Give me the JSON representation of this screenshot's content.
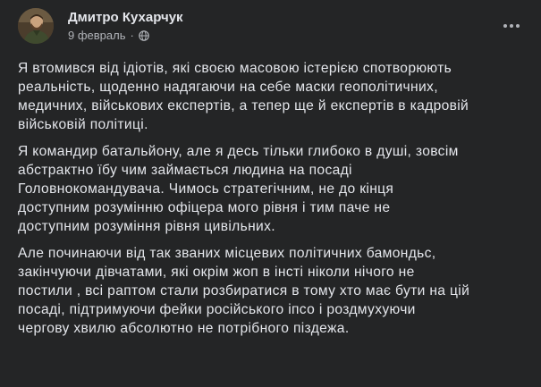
{
  "post": {
    "author": "Дмитро Кухарчук",
    "date": "9 февраль",
    "separator": "·",
    "privacy_icon": "globe-icon",
    "more_icon": "more-horizontal-icon",
    "paragraphs": [
      {
        "lines": [
          "Я втомився від ідіотів, які своєю масовою істерією спотворюють",
          "реальність, щоденно надягаючи на себе маски геополітичних,",
          "медичних, військових експертів, а тепер ще й експертів в кадровій",
          "військовій політиці."
        ]
      },
      {
        "lines": [
          "Я командир батальйону, але я десь тільки глибоко в душі, зовсім",
          "абстрактно їбу чим займається людина на посаді",
          "Головнокомандувача. Чимось стратегічним, не до кінця",
          "доступним розумінню офіцера мого рівня і тим паче не",
          "доступним розуміння рівня цивільних."
        ]
      },
      {
        "lines": [
          "Але починаючи від так званих місцевих політичних бамондьс,",
          "закінчуючи дівчатами, які окрім жоп в інсті ніколи нічого не",
          "постили , всі раптом стали розбиратися в тому хто має бути на цій",
          "посаді, підтримуючи фейки російського іпсо і роздмухуючи",
          "чергову хвилю абсолютно не потрібного піздежа."
        ]
      }
    ]
  },
  "colors": {
    "background": "#242526",
    "text_primary": "#e4e6eb",
    "text_secondary": "#b0b3b8"
  }
}
